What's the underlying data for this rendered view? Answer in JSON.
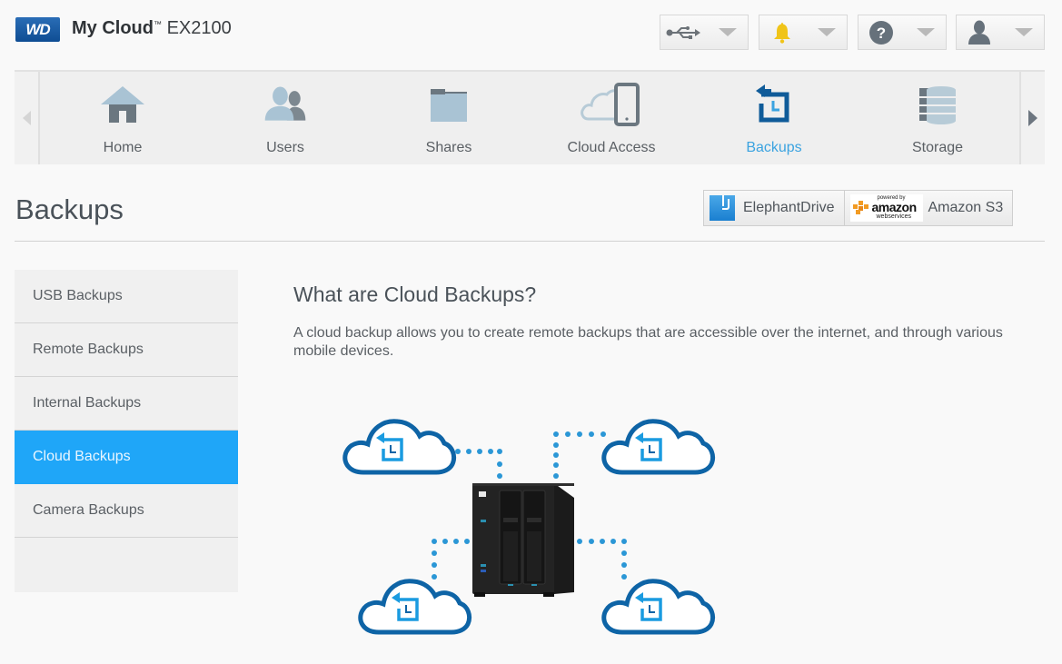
{
  "header": {
    "logo_text": "WD",
    "app_name": "My Cloud",
    "trademark": "™",
    "model": "EX2100",
    "buttons": [
      {
        "name": "usb",
        "icon": "usb-icon"
      },
      {
        "name": "notifications",
        "icon": "bell-icon"
      },
      {
        "name": "help",
        "icon": "help-icon",
        "glyph": "?"
      },
      {
        "name": "user",
        "icon": "user-icon"
      }
    ]
  },
  "nav": {
    "items": [
      {
        "label": "Home",
        "icon": "home-icon"
      },
      {
        "label": "Users",
        "icon": "users-icon"
      },
      {
        "label": "Shares",
        "icon": "folder-icon"
      },
      {
        "label": "Cloud Access",
        "icon": "cloud-access-icon"
      },
      {
        "label": "Backups",
        "icon": "backup-icon",
        "active": true
      },
      {
        "label": "Storage",
        "icon": "storage-icon"
      }
    ]
  },
  "page": {
    "title": "Backups",
    "providers": [
      {
        "label": "ElephantDrive",
        "icon": "elephantdrive-logo"
      },
      {
        "label": "Amazon S3",
        "icon": "aws-logo",
        "logo_top": "powered by",
        "logo_main": "amazon",
        "logo_sub": "webservices"
      }
    ]
  },
  "sidebar": {
    "items": [
      {
        "label": "USB Backups"
      },
      {
        "label": "Remote Backups"
      },
      {
        "label": "Internal Backups"
      },
      {
        "label": "Cloud Backups",
        "active": true
      },
      {
        "label": "Camera Backups"
      }
    ]
  },
  "content": {
    "title": "What are Cloud Backups?",
    "description": "A cloud backup allows you to create remote backups that are accessible over the internet, and through various mobile devices."
  },
  "colors": {
    "accent": "#1fa6f8",
    "active_nav_text": "#3ba3e0",
    "cloud_outline": "#0e64a6",
    "backup_icon": "#1a9be0",
    "bell": "#f0c419"
  }
}
